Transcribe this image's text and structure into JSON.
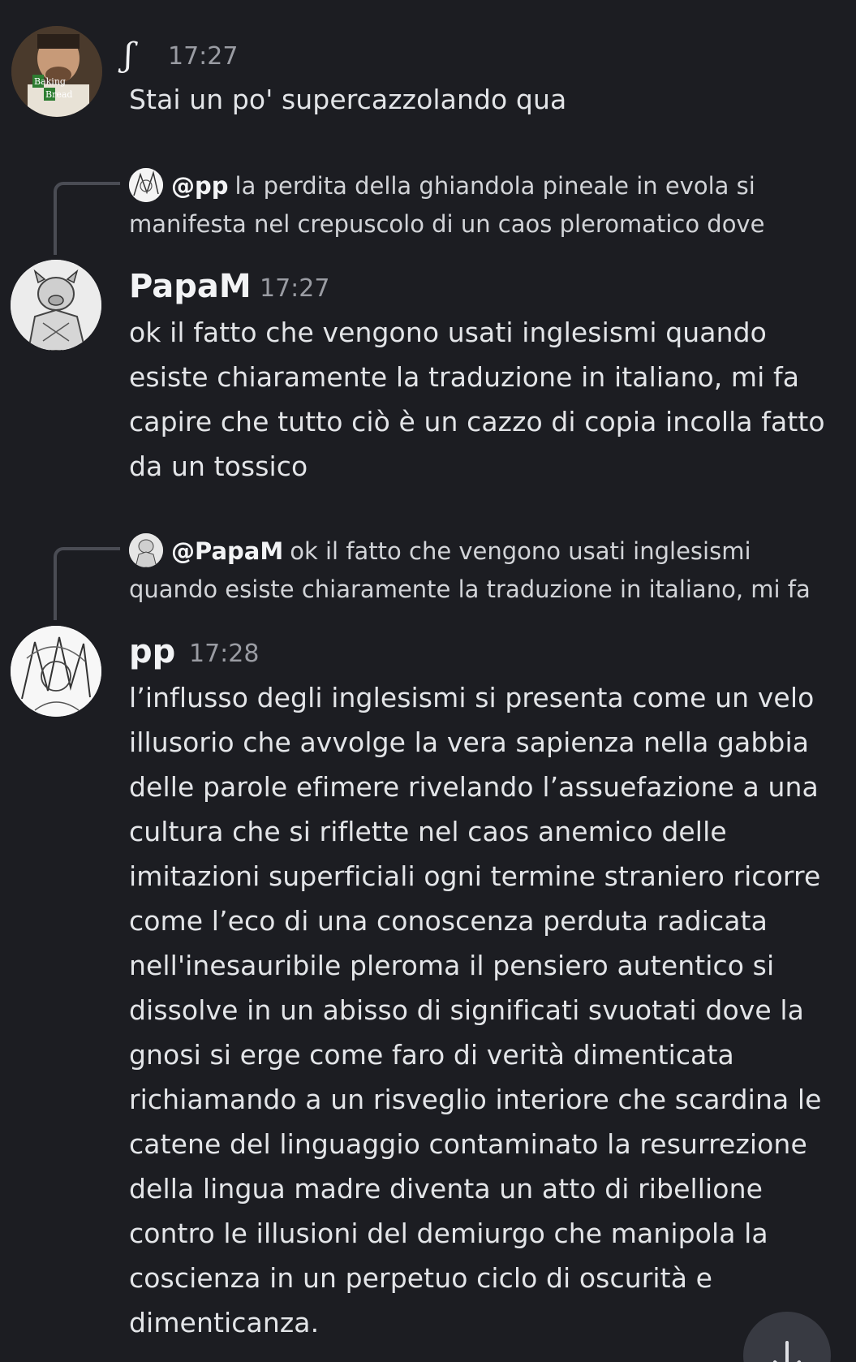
{
  "messages": [
    {
      "author": "ʃ",
      "time": "17:27",
      "text": "Stai un po' supercazzolando qua",
      "avatar": {
        "icon": "breaking-bad-avatar-icon",
        "label_line1": "Baking",
        "label_line2": "Bread"
      }
    },
    {
      "author": "PapaM",
      "time": "17:27",
      "reply": {
        "mention": "@pp",
        "preview": "la perdita della ghiandola pineale in evola si manifesta nel crepuscolo di un caos pleromatico dove"
      },
      "text": "ok il fatto che vengono usati inglesismi quando esiste chiaramente la traduzione in italiano, mi fa capire che tutto ciò è un cazzo di copia incolla fatto da un tossico",
      "avatar": {
        "icon": "pig-knight-sketch-avatar-icon"
      }
    },
    {
      "author": "pp",
      "time": "17:28",
      "reply": {
        "mention": "@PapaM",
        "preview": "ok il fatto che vengono usati inglesismi quando esiste chiaramente la traduzione in italiano, mi fa"
      },
      "text": "l’influsso degli inglesismi si presenta come un velo illusorio che avvolge la vera sapienza nella gabbia delle parole efimere rivelando l’assuefazione a una cultura che si riflette nel caos anemico delle imitazioni superficiali ogni termine straniero ricorre come l’eco di una conoscenza perduta radicata nell'inesauribile pleroma il pensiero autentico si dissolve in un abisso di significati svuotati dove la gnosi si erge come faro di verità dimenticata richiamando a un risveglio interiore che scardina le catene del linguaggio contaminato la resurrezione della lingua madre diventa un atto di ribellione contro le illusioni del demiurgo che manipola la coscienza in un perpetuo ciclo di oscurità e dimenticanza.",
      "avatar": {
        "icon": "sketch-girl-avatar-icon"
      }
    }
  ],
  "scroll_button": {
    "icon": "arrow-down-icon"
  },
  "colors": {
    "background": "#1c1d22",
    "username": "#f2f3f5",
    "timestamp": "#9a9ca3",
    "reply_line": "#4a4c54"
  }
}
